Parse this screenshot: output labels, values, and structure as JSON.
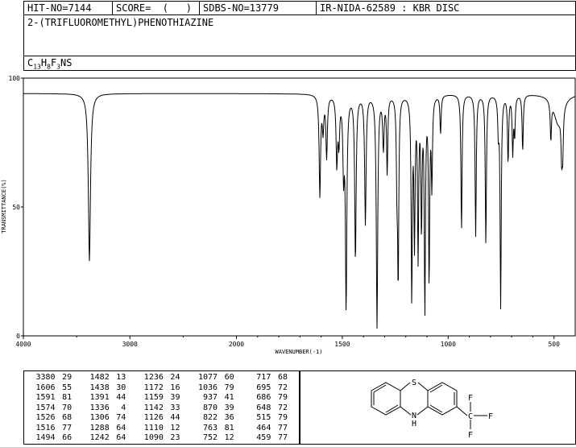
{
  "header": {
    "hit_no": "HIT-NO=7144",
    "score": "SCORE=  (   )",
    "sdbs_no": "SDBS-NO=13779",
    "ir_code": "IR-NIDA-62589 : KBR DISC"
  },
  "compound_name": "2-(TRIFLUOROMETHYL)PHENOTHIAZINE",
  "formula": {
    "c": "C",
    "c_n": "13",
    "h": "H",
    "h_n": "8",
    "f": "F",
    "f_n": "3",
    "rest": "NS"
  },
  "chart_data": {
    "type": "line",
    "xlabel": "WAVENUMBER(-1)",
    "ylabel": "TRANSMITTANCE(%)",
    "xlim": [
      4000,
      400
    ],
    "ylim": [
      0,
      100
    ],
    "x_ticks": [
      "4000",
      "3000",
      "2000",
      "1500",
      "1000",
      "500"
    ],
    "y_ticks": [
      "100",
      "50",
      "0"
    ],
    "x_axis_note": "split scale: 4000-2000 compressed, 2000-400 expanded",
    "baseline": 94,
    "peaks": [
      {
        "wn": 3380,
        "t": 29
      },
      {
        "wn": 1606,
        "t": 55
      },
      {
        "wn": 1591,
        "t": 81
      },
      {
        "wn": 1574,
        "t": 70
      },
      {
        "wn": 1526,
        "t": 68
      },
      {
        "wn": 1516,
        "t": 77
      },
      {
        "wn": 1494,
        "t": 66
      },
      {
        "wn": 1482,
        "t": 13
      },
      {
        "wn": 1438,
        "t": 30
      },
      {
        "wn": 1391,
        "t": 44
      },
      {
        "wn": 1336,
        "t": 4
      },
      {
        "wn": 1306,
        "t": 74
      },
      {
        "wn": 1288,
        "t": 64
      },
      {
        "wn": 1242,
        "t": 64
      },
      {
        "wn": 1236,
        "t": 24
      },
      {
        "wn": 1172,
        "t": 16
      },
      {
        "wn": 1159,
        "t": 39
      },
      {
        "wn": 1142,
        "t": 33
      },
      {
        "wn": 1126,
        "t": 44
      },
      {
        "wn": 1110,
        "t": 12
      },
      {
        "wn": 1090,
        "t": 23
      },
      {
        "wn": 1077,
        "t": 60
      },
      {
        "wn": 1036,
        "t": 79
      },
      {
        "wn": 937,
        "t": 41
      },
      {
        "wn": 870,
        "t": 39
      },
      {
        "wn": 822,
        "t": 36
      },
      {
        "wn": 763,
        "t": 81
      },
      {
        "wn": 752,
        "t": 12
      },
      {
        "wn": 717,
        "t": 68
      },
      {
        "wn": 695,
        "t": 72
      },
      {
        "wn": 686,
        "t": 79
      },
      {
        "wn": 648,
        "t": 72
      },
      {
        "wn": 515,
        "t": 79
      },
      {
        "wn": 464,
        "t": 77
      },
      {
        "wn": 459,
        "t": 77
      }
    ]
  },
  "peak_table": [
    [
      "3380",
      "29",
      "1482",
      "13",
      "1236",
      "24",
      "1077",
      "60",
      "717",
      "68"
    ],
    [
      "1606",
      "55",
      "1438",
      "30",
      "1172",
      "16",
      "1036",
      "79",
      "695",
      "72"
    ],
    [
      "1591",
      "81",
      "1391",
      "44",
      "1159",
      "39",
      "937",
      "41",
      "686",
      "79"
    ],
    [
      "1574",
      "70",
      "1336",
      "4",
      "1142",
      "33",
      "870",
      "39",
      "648",
      "72"
    ],
    [
      "1526",
      "68",
      "1306",
      "74",
      "1126",
      "44",
      "822",
      "36",
      "515",
      "79"
    ],
    [
      "1516",
      "77",
      "1288",
      "64",
      "1110",
      "12",
      "763",
      "81",
      "464",
      "77"
    ],
    [
      "1494",
      "66",
      "1242",
      "64",
      "1090",
      "23",
      "752",
      "12",
      "459",
      "77"
    ]
  ],
  "structure_labels": {
    "s": "S",
    "nh": "N\nH",
    "n": "N",
    "h": "H",
    "c": "C",
    "f": "F"
  }
}
